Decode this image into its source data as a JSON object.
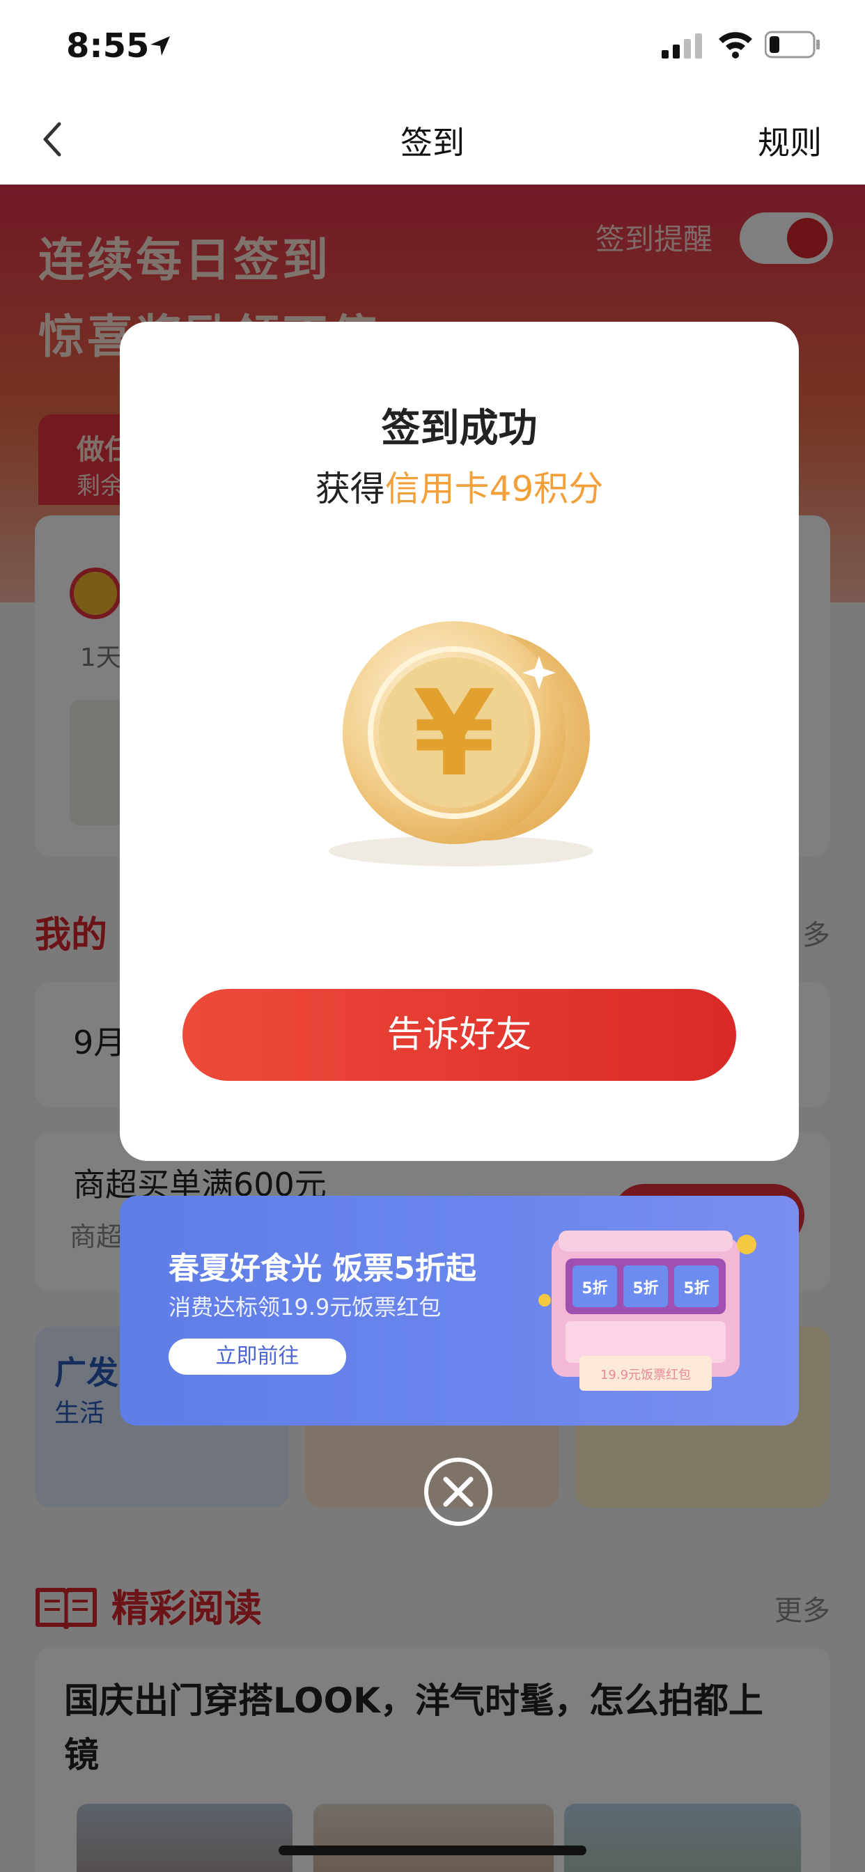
{
  "status_bar": {
    "time": "8:55"
  },
  "nav": {
    "title": "签到",
    "rules": "规则"
  },
  "hero": {
    "line1": "连续每日签到",
    "line2": "惊喜奖励领不停",
    "reminder_label": "签到提醒",
    "reminder_on": true
  },
  "task_tab": {
    "title": "做任",
    "sub": "剩余"
  },
  "checkin": {
    "day_label": "1天"
  },
  "my_section": {
    "title": "我的",
    "more": "多"
  },
  "offers": [
    {
      "title": "9月"
    },
    {
      "title": "商超买单满600元",
      "sub": "商超"
    }
  ],
  "tiles": {
    "first_title": "广发",
    "first_sub": "生活"
  },
  "reading": {
    "title": "精彩阅读",
    "more": "更多",
    "article_title": "国庆出门穿搭LOOK，洋气时髦，怎么拍都上镜"
  },
  "modal": {
    "title": "签到成功",
    "sub_prefix": "获得",
    "sub_highlight": "信用卡49积分",
    "share_button": "告诉好友"
  },
  "banner": {
    "title": "春夏好食光 饭票5折起",
    "sub": "消费达标领19.9元饭票红包",
    "button": "立即前往",
    "badge_text": "5折",
    "ticket_text": "19.9元饭票红包"
  },
  "colors": {
    "accent": "#e8303f",
    "highlight": "#f3a03a",
    "banner": "#6a86ec"
  }
}
